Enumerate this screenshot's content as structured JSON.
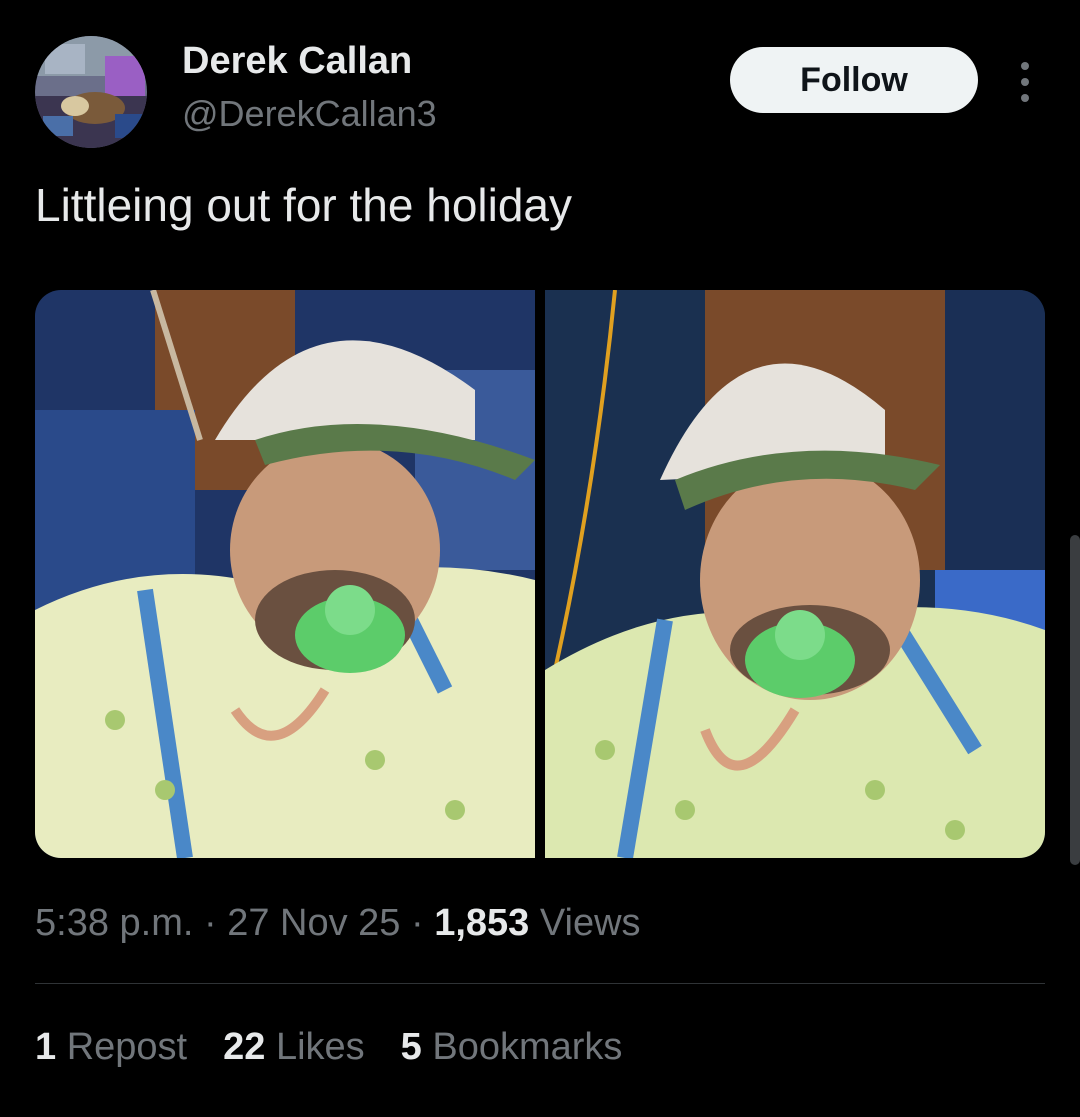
{
  "tweet": {
    "author": {
      "name": "Derek Callan",
      "handle": "@DerekCallan3"
    },
    "follow_label": "Follow",
    "more_icon": "more-vertical-icon",
    "text": "Littleing out for the holiday",
    "media": [
      {
        "description_icon": "photo"
      },
      {
        "description_icon": "photo"
      }
    ],
    "meta": {
      "time": "5:38 p.m.",
      "separator": " · ",
      "date": "27 Nov 25",
      "views_count": "1,853",
      "views_label": " Views"
    },
    "stats": {
      "reposts_count": "1",
      "reposts_label": " Repost",
      "likes_count": "22",
      "likes_label": " Likes",
      "bookmarks_count": "5",
      "bookmarks_label": " Bookmarks"
    }
  },
  "colors": {
    "background": "#000000",
    "primary_text": "#e7e9ea",
    "secondary_text": "#71767b",
    "follow_bg": "#eff3f4"
  }
}
